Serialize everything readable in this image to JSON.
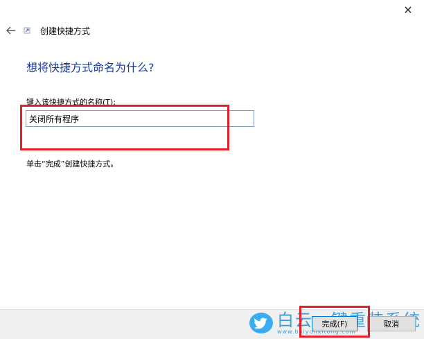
{
  "window": {
    "close_label": "✕"
  },
  "header": {
    "back_icon": "back-arrow-icon",
    "wizard_icon": "shortcut-icon",
    "wizard_title": "创建快捷方式"
  },
  "main": {
    "heading": "想将快捷方式命名为什么?",
    "field_label": "键入该快捷方式的名称(T):",
    "name_value": "关闭所有程序",
    "hint": "单击“完成”创建快捷方式。"
  },
  "footer": {
    "finish_label": "完成(F)",
    "cancel_label": "取消"
  },
  "watermark": {
    "text": "白云一键重装系统",
    "url": "www.baiyunxitong.com"
  },
  "colors": {
    "heading": "#1a3b9c",
    "annotation": "#e0202a",
    "input_border": "#7a9cc4",
    "footer_bg": "#f0f0f0",
    "primary_border": "#0078d7"
  }
}
